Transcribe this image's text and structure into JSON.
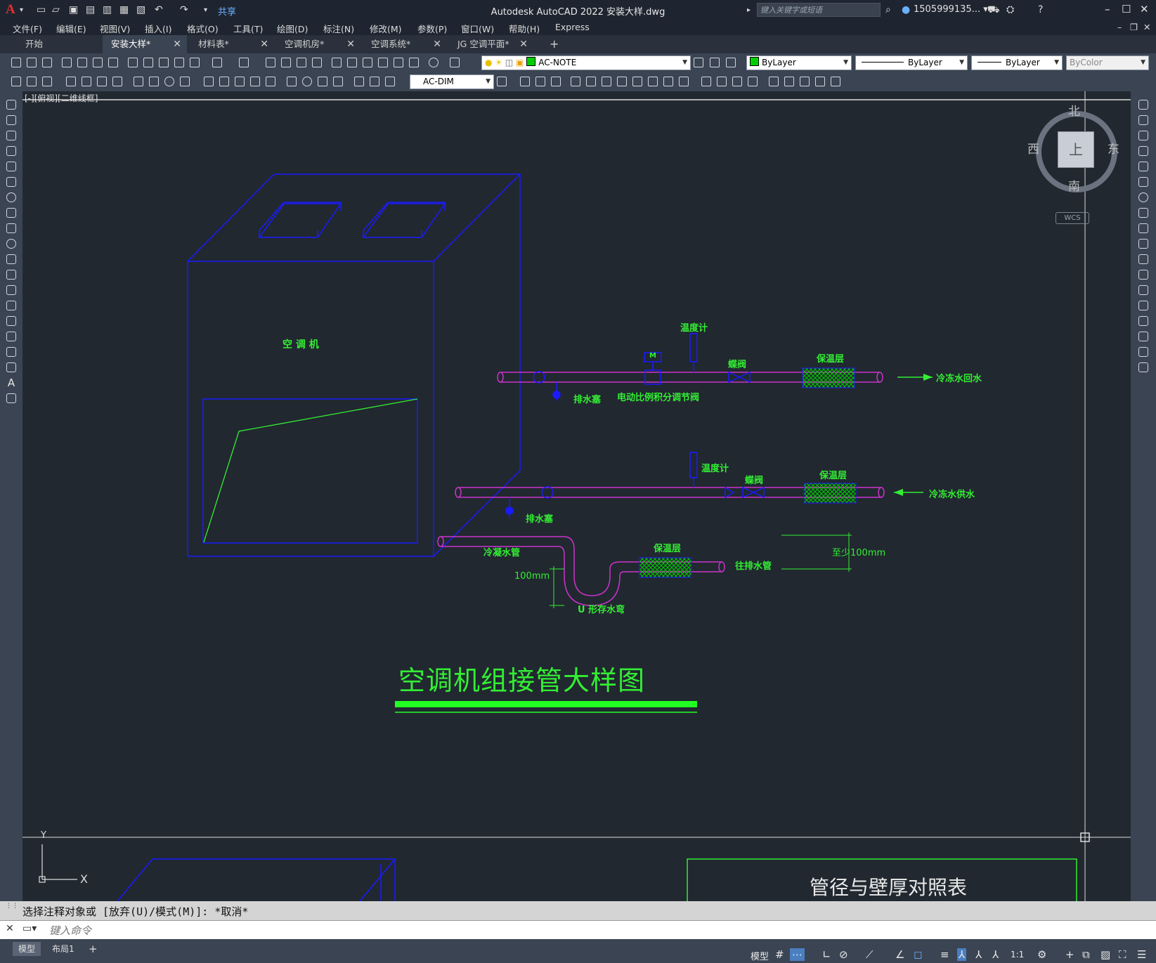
{
  "titlebar": {
    "title": "Autodesk AutoCAD 2022    安装大样.dwg",
    "share": "共享",
    "search_placeholder": "键入关键字或短语",
    "user": "1505999135... ▾",
    "logo": "A"
  },
  "menu": [
    "文件(F)",
    "编辑(E)",
    "视图(V)",
    "插入(I)",
    "格式(O)",
    "工具(T)",
    "绘图(D)",
    "标注(N)",
    "修改(M)",
    "参数(P)",
    "窗口(W)",
    "帮助(H)",
    "Express"
  ],
  "tabs": [
    {
      "label": "开始",
      "active": false,
      "closable": false
    },
    {
      "label": "安装大样*",
      "active": true,
      "closable": true
    },
    {
      "label": "材料表*",
      "active": false,
      "closable": true
    },
    {
      "label": "空调机房*",
      "active": false,
      "closable": true
    },
    {
      "label": "空调系统*",
      "active": false,
      "closable": true
    },
    {
      "label": "JG 空调平面*",
      "active": false,
      "closable": true
    }
  ],
  "toolbar": {
    "layer": "AC-NOTE",
    "color": "ByLayer",
    "linetype": "ByLayer",
    "lineweight": "ByLayer",
    "plotstyle": "ByColor",
    "dimstyle": "AC-DIM"
  },
  "viewport_label": "[-][俯视][二维线框]",
  "viewcube": {
    "north": "北",
    "south": "南",
    "east": "东",
    "west": "西",
    "top": "上",
    "wcs": "WCS"
  },
  "drawing": {
    "unit_label": "空 调 机",
    "thermometer_1": "温度计",
    "butterfly_valve_1": "蝶阀",
    "insulation_1": "保温层",
    "return_water": "冷冻水回水",
    "drain_plug_1": "排水塞",
    "proportional_valve": "电动比例积分调节阀",
    "motor_label": "M",
    "thermometer_2": "温度计",
    "butterfly_valve_2": "蝶阀",
    "insulation_2": "保温层",
    "supply_water": "冷冻水供水",
    "drain_plug_2": "排水塞",
    "condensate_pipe": "冷凝水管",
    "insulation_3": "保温层",
    "to_drain": "往排水管",
    "min_100": "至少100mm",
    "dim_100": "100mm",
    "u_trap": "U 形存水弯",
    "title": "空调机组接管大样图",
    "table_title": "管径与壁厚对照表"
  },
  "ucs": {
    "x": "X",
    "y": "Y"
  },
  "command": {
    "history": "选择注释对象或 [放弃(U)/模式(M)]: *取消*",
    "placeholder": "键入命令"
  },
  "status": {
    "tabs": [
      {
        "label": "模型",
        "active": true
      },
      {
        "label": "布局1",
        "active": false
      }
    ],
    "model_label": "模型",
    "scale": "1:1"
  },
  "colors": {
    "background": "#212830",
    "pipe": "#cc33cc",
    "outline": "#1a1aff",
    "text": "#33ee33",
    "insulation": "#00cc00"
  }
}
